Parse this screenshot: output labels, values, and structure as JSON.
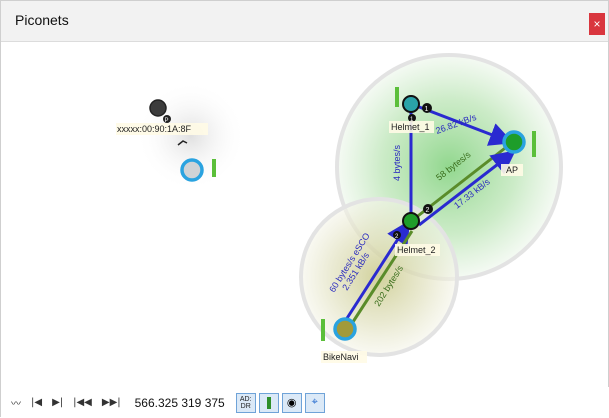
{
  "window": {
    "title": "Piconets",
    "close_label": "×"
  },
  "nodes": {
    "unknown_device": "xxxxx:00:90:1A:8F",
    "helmet1": "Helmet_1",
    "helmet2": "Helmet_2",
    "ap": "AP",
    "bikenavi": "BikeNavi"
  },
  "badges": {
    "helmet1": "1",
    "helmet2": "2",
    "unknown": "P",
    "helmet1_b": "1",
    "helmet2_b": "2"
  },
  "links": {
    "ap_helmet1": "26.82 kB/s",
    "helmet1_helmet2": "4 bytes/s",
    "ap_helmet2_a": "58 bytes/s",
    "ap_helmet2_b": "17.33 kB/s",
    "bike_helmet2_esco": "60 bytes/s eSCO",
    "bike_helmet2_kb": "2.351 kB/s",
    "bike_helmet2_b": "202 bytes/s"
  },
  "toolbar": {
    "time": "566.325 319 375",
    "mode_ad": "AD:",
    "mode_dr": "DR"
  },
  "icons": [
    "wave-icon",
    "skip-start-icon",
    "step-back-icon",
    "rewind-icon",
    "fast-forward-icon",
    "battery-icon",
    "eye-icon",
    "target-icon"
  ]
}
